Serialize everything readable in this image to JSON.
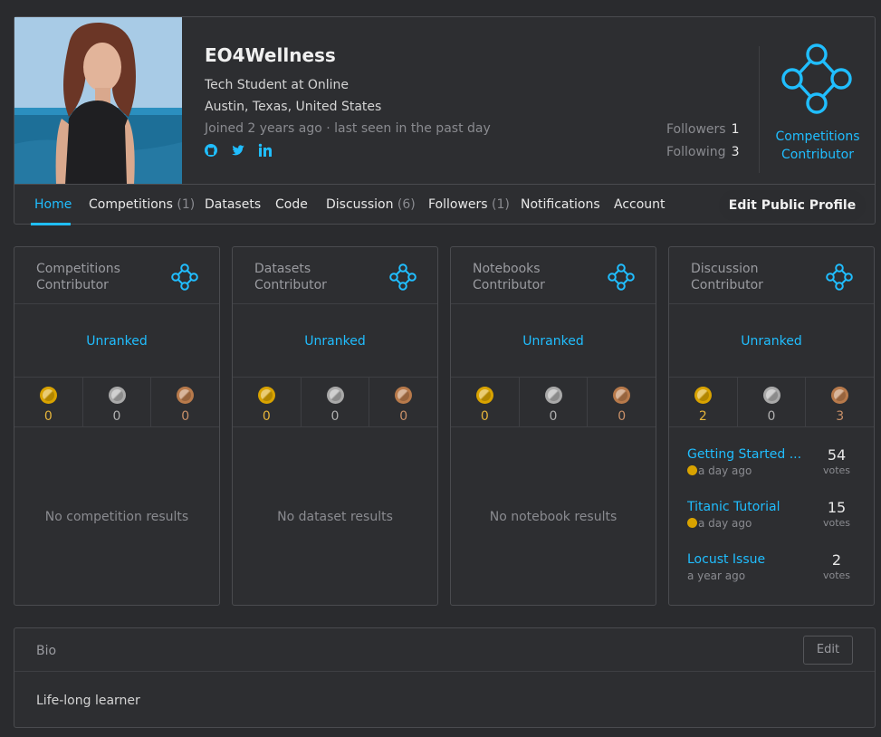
{
  "profile": {
    "name": "EO4Wellness",
    "occupation": "Tech Student at Online",
    "location": "Austin, Texas, United States",
    "joined": "Joined 2 years ago · last seen in the past day",
    "followers_label": "Followers",
    "followers_count": "1",
    "following_label": "Following",
    "following_count": "3",
    "tier": "Competitions Contributor"
  },
  "nav": {
    "home": "Home",
    "competitions": "Competitions",
    "competitions_count": "(1)",
    "datasets": "Datasets",
    "code": "Code",
    "discussion": "Discussion",
    "discussion_count": "(6)",
    "followers": "Followers",
    "followers_count": "(1)",
    "notifications": "Notifications",
    "account": "Account",
    "edit_profile": "Edit Public Profile"
  },
  "cards": [
    {
      "title": "Competitions Contributor",
      "rank": "Unranked",
      "gold": "0",
      "silver": "0",
      "bronze": "0",
      "empty": "No competition results"
    },
    {
      "title": "Datasets Contributor",
      "rank": "Unranked",
      "gold": "0",
      "silver": "0",
      "bronze": "0",
      "empty": "No dataset results"
    },
    {
      "title": "Notebooks Contributor",
      "rank": "Unranked",
      "gold": "0",
      "silver": "0",
      "bronze": "0",
      "empty": "No notebook results"
    },
    {
      "title": "Discussion Contributor",
      "rank": "Unranked",
      "gold": "2",
      "silver": "0",
      "bronze": "3"
    }
  ],
  "discussion_posts": [
    {
      "title": "Getting Started ...",
      "meta": "a day ago",
      "votes": "54",
      "votes_label": "votes"
    },
    {
      "title": "Titanic Tutorial",
      "meta": "a day ago",
      "votes": "15",
      "votes_label": "votes"
    },
    {
      "title": "Locust Issue",
      "meta": "a year ago",
      "votes": "2",
      "votes_label": "votes"
    }
  ],
  "bio": {
    "title": "Bio",
    "edit_label": "Edit",
    "text": "Life-long learner"
  },
  "icons": {
    "social": [
      "github-icon",
      "twitter-icon",
      "linkedin-icon"
    ],
    "tier": "contributor-tier-icon"
  },
  "colors": {
    "accent": "#20beff",
    "background": "#2a2b2e",
    "gold": "#d9a300",
    "silver": "#a9a9a9",
    "bronze": "#b87a4b"
  }
}
